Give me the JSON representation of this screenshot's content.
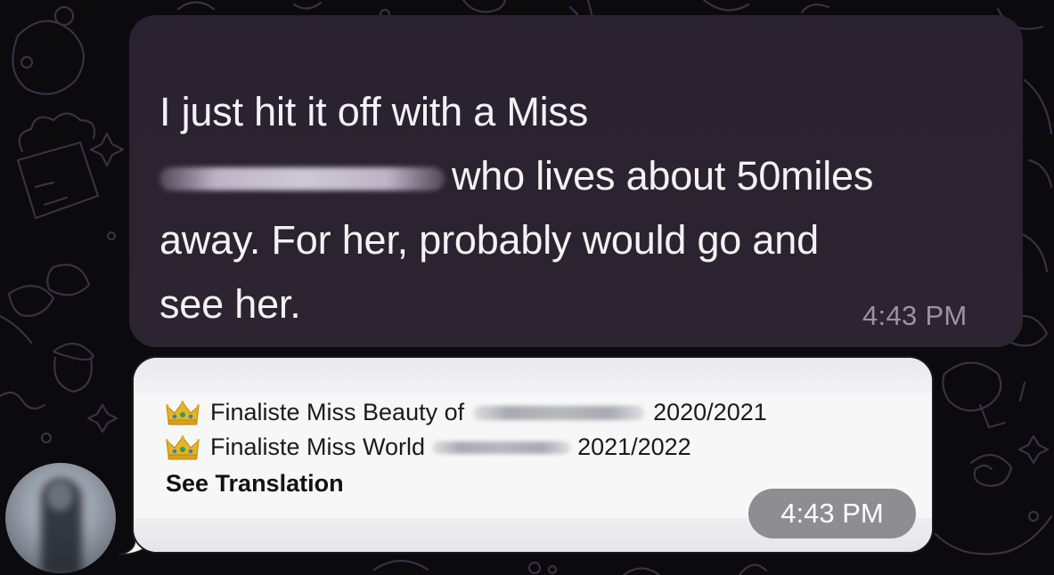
{
  "chat": {
    "incoming_message": {
      "line1": "I just hit it off with a Miss",
      "line2_after_redaction": "who lives about 50miles",
      "line3": "away. For her, probably would go and",
      "line4": "see her.",
      "time": "4:43 PM"
    },
    "forwarded_message": {
      "line1_prefix": "Finaliste Miss Beauty of",
      "line1_suffix": "2020/2021",
      "line2_prefix": "Finaliste Miss World",
      "line2_suffix": "2021/2022",
      "crown_icon": "crown-emoji-icon",
      "translate_link": "See Translation",
      "time": "4:43 PM"
    },
    "sender_avatar": "avatar"
  },
  "colors": {
    "background": "#0b0a0d",
    "doodle": "#3a3046",
    "dark_bubble": "#2b2330",
    "light_bubble": "#f7f7f8",
    "time_pill": "#8e8e92"
  }
}
